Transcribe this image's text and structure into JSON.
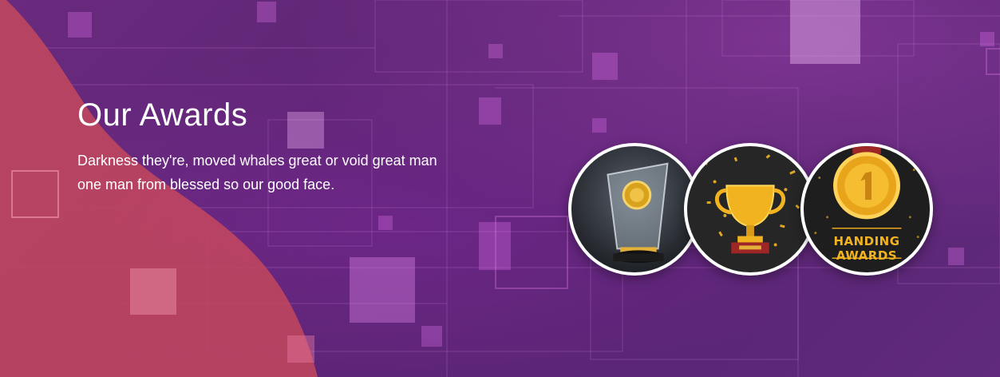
{
  "section": {
    "title": "Our Awards",
    "description_line1": "Darkness they're, moved whales great or void great man",
    "description_line2": "one man from blessed so our good face."
  },
  "awards": [
    {
      "icon": "glass-trophy-icon"
    },
    {
      "icon": "gold-cup-trophy-icon"
    },
    {
      "icon": "gold-medal-icon",
      "caption_line1": "HANDING",
      "caption_line2": "AWARDS"
    }
  ],
  "colors": {
    "background": "#5b2573",
    "wave": "#c2475e",
    "text": "#ffffff",
    "gold": "#f2b320"
  }
}
